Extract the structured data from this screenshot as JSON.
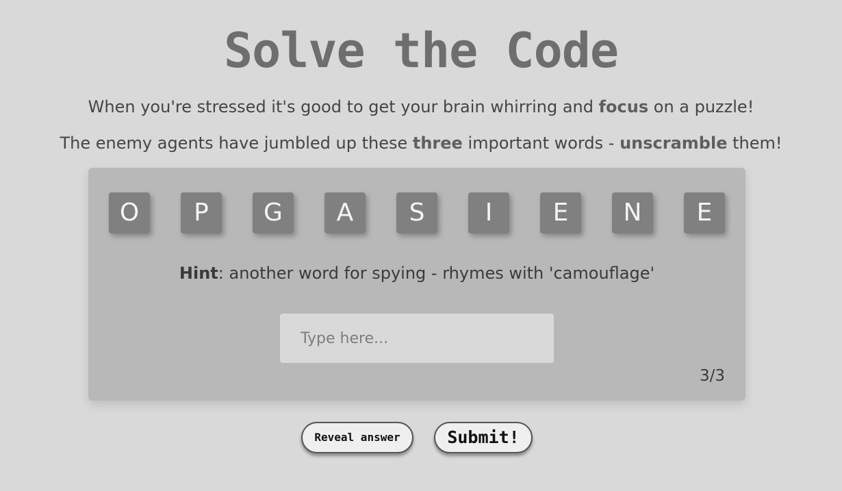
{
  "title": "Solve the Code",
  "intro": {
    "line1_a": "When you're stressed it's good to get your brain whirring and ",
    "line1_bold": "focus",
    "line1_b": " on a puzzle!",
    "line2_a": "The enemy agents have jumbled up these ",
    "line2_bold1": "three",
    "line2_b": " important words - ",
    "line2_bold2": "unscramble",
    "line2_c": " them!"
  },
  "puzzle": {
    "letters": [
      "O",
      "P",
      "G",
      "A",
      "S",
      "I",
      "E",
      "N",
      "E"
    ],
    "hint_label": "Hint",
    "hint_text": ": another word for spying - rhymes with 'camouflage'",
    "input_placeholder": "Type here...",
    "input_value": "",
    "counter": "3/3"
  },
  "buttons": {
    "reveal": "Reveal answer",
    "submit": "Submit!"
  },
  "colors": {
    "background": "#d9d9d9",
    "panel": "#b8b8b8",
    "tile": "#808080",
    "title": "#6e6e6e"
  }
}
